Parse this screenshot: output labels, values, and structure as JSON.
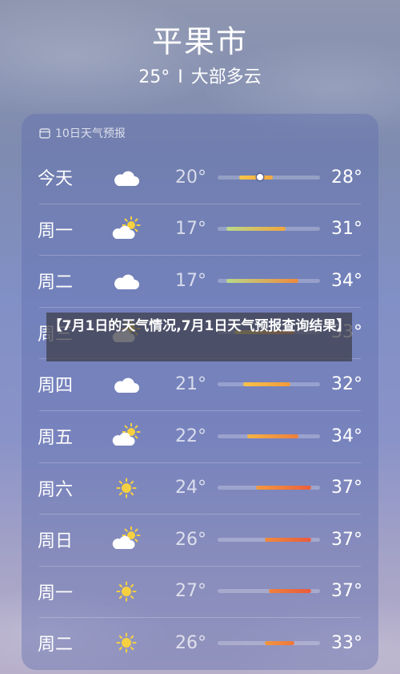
{
  "header": {
    "city": "平果市",
    "temp": "25°",
    "separator": "I",
    "condition": "大部多云"
  },
  "forecast": {
    "title": "10日天气预报",
    "calendar_icon": "calendar-icon",
    "days": [
      {
        "day": "今天",
        "icon": "cloud-icon",
        "low": "20°",
        "high": "28°",
        "range": [
          20,
          28
        ],
        "colors": [
          "#f7c64a",
          "#f4a83a"
        ],
        "current": 25
      },
      {
        "day": "周一",
        "icon": "partly-sunny-icon",
        "low": "17°",
        "high": "31°",
        "range": [
          17,
          31
        ],
        "colors": [
          "#b9d98a",
          "#f3a53c"
        ]
      },
      {
        "day": "周二",
        "icon": "cloud-icon",
        "low": "17°",
        "high": "34°",
        "range": [
          17,
          34
        ],
        "colors": [
          "#b9d98a",
          "#f08a3a"
        ]
      },
      {
        "day": "周三",
        "icon": "partly-sunny-icon",
        "low": "",
        "high": "33°",
        "range": [
          19,
          33
        ],
        "colors": [
          "#dfd36a",
          "#f1913b"
        ]
      },
      {
        "day": "周四",
        "icon": "cloud-icon",
        "low": "21°",
        "high": "32°",
        "range": [
          21,
          32
        ],
        "colors": [
          "#f6c24a",
          "#f39a3b"
        ]
      },
      {
        "day": "周五",
        "icon": "partly-sunny-icon",
        "low": "22°",
        "high": "34°",
        "range": [
          22,
          34
        ],
        "colors": [
          "#f5b545",
          "#ee7e3c"
        ]
      },
      {
        "day": "周六",
        "icon": "sun-icon",
        "low": "24°",
        "high": "37°",
        "range": [
          24,
          37
        ],
        "colors": [
          "#f39a3e",
          "#ec5f3d"
        ]
      },
      {
        "day": "周日",
        "icon": "partly-sunny-icon",
        "low": "26°",
        "high": "37°",
        "range": [
          26,
          37
        ],
        "colors": [
          "#f08b3e",
          "#ea5b3d"
        ]
      },
      {
        "day": "周一",
        "icon": "sun-icon",
        "low": "27°",
        "high": "37°",
        "range": [
          27,
          37
        ],
        "colors": [
          "#ef803e",
          "#ea5a3d"
        ]
      },
      {
        "day": "周二",
        "icon": "sun-icon",
        "low": "26°",
        "high": "33°",
        "range": [
          26,
          33
        ],
        "colors": [
          "#f2953e",
          "#ee763c"
        ]
      }
    ]
  },
  "overlay": {
    "text": "【7月1日的天气情况,7月1日天气预报查询结果】"
  }
}
